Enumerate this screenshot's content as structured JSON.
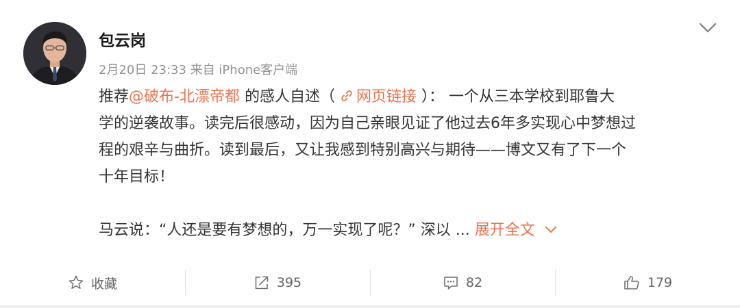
{
  "post": {
    "author": "包云岗",
    "date": "2月20日",
    "time": "23:33",
    "source": "来自 iPhone客户端",
    "text": {
      "l1_a": "推荐",
      "mention": "@破布-北漂帝都",
      "l1_b": " 的感人自述（ ",
      "link": "网页链接",
      "l1_c": " ）： 一个从三本学校到耶鲁大",
      "l2": "学的逆袭故事。读完后很感动，因为自己亲眼见证了他过去6年多实现心中梦想过",
      "l3": "程的艰辛与曲折。读到最后，又让我感到特别高兴与期待——博文又有了下一个",
      "l4": "十年目标！",
      "p2": "马云说：“人还是要有梦想的，万一实现了呢？” 深以 ... ",
      "expand": "展开全文"
    }
  },
  "actions": {
    "favorite_label": "收藏",
    "repost_count": "395",
    "comment_count": "82",
    "like_count": "179"
  },
  "colors": {
    "accent": "#eb7350",
    "text": "#333333",
    "meta": "#939393"
  },
  "icons": [
    "chevron-down-icon",
    "link-icon",
    "star-icon",
    "repost-icon",
    "comment-icon",
    "thumbs-up-icon"
  ]
}
